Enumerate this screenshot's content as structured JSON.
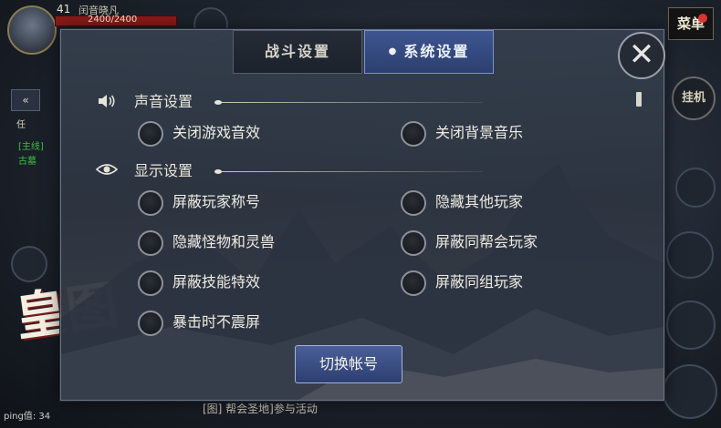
{
  "hud": {
    "level": "41",
    "player_name": "闰音晓凡",
    "hp_text": "2400/2400",
    "menu_label": "菜单",
    "auto_label": "挂机",
    "collapse_label": "«",
    "quest_prefix": "任",
    "quest_main": "[主线]",
    "quest_sub": "古墓",
    "ping_label": "ping值",
    "ping_value": "34",
    "bottom_notice": "[图] 帮会圣地]参与活动",
    "logo_text": "皇图",
    "colors": {
      "accent": "#3d5590",
      "hp": "#8b1a1a",
      "quest_green": "#3fbf3f"
    }
  },
  "dialog": {
    "tabs": [
      {
        "label": "战斗设置",
        "active": false
      },
      {
        "label": "系统设置",
        "active": true
      }
    ],
    "close_icon": "close-x-icon",
    "sections": {
      "sound": {
        "title": "声音设置",
        "icon": "speaker-icon",
        "options": [
          {
            "label": "关闭游戏音效",
            "checked": false
          },
          {
            "label": "关闭背景音乐",
            "checked": false
          }
        ]
      },
      "display": {
        "title": "显示设置",
        "icon": "eye-icon",
        "options": [
          {
            "label": "屏蔽玩家称号",
            "checked": false
          },
          {
            "label": "隐藏其他玩家",
            "checked": false
          },
          {
            "label": "隐藏怪物和灵兽",
            "checked": false
          },
          {
            "label": "屏蔽同帮会玩家",
            "checked": false
          },
          {
            "label": "屏蔽技能特效",
            "checked": false
          },
          {
            "label": "屏蔽同组玩家",
            "checked": false
          },
          {
            "label": "暴击时不震屏",
            "checked": false
          }
        ]
      }
    },
    "switch_account_label": "切换帐号"
  }
}
